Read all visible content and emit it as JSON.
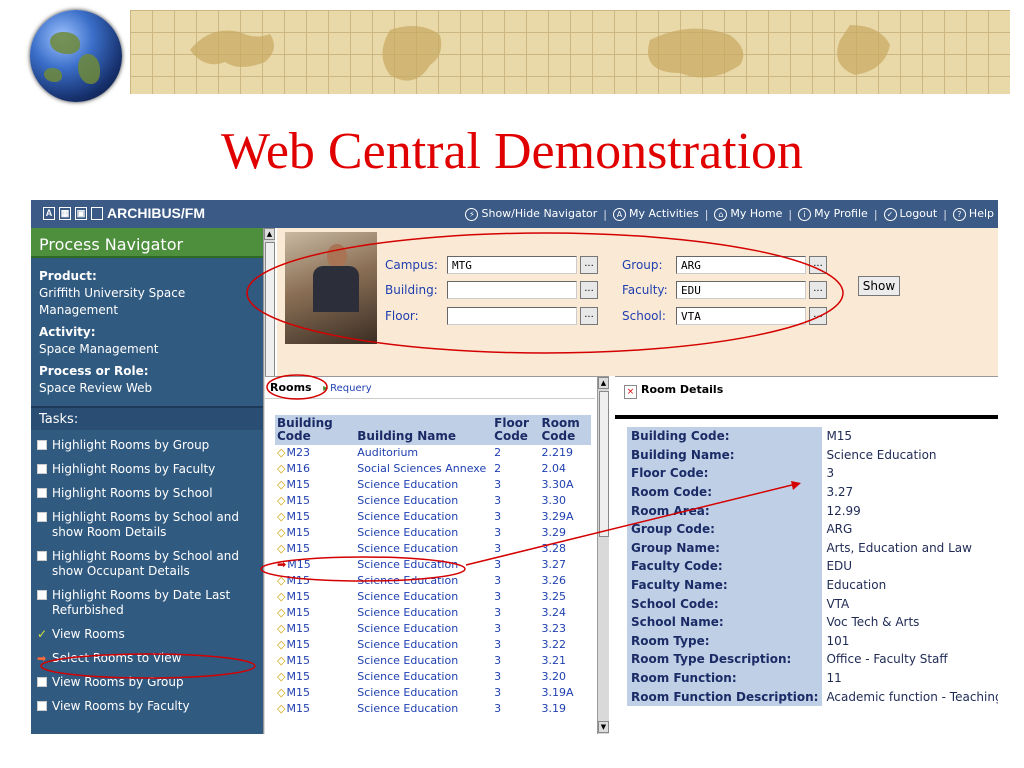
{
  "slide": {
    "title": "Web Central Demonstration"
  },
  "app": {
    "brand": "ARCHIBUS/FM",
    "topnav": [
      {
        "icon": "lightning-icon",
        "label": "Show/Hide Navigator"
      },
      {
        "icon": "activities-icon",
        "label": "My Activities"
      },
      {
        "icon": "home-icon",
        "label": "My Home"
      },
      {
        "icon": "profile-icon",
        "label": "My Profile"
      },
      {
        "icon": "logout-icon",
        "label": "Logout"
      },
      {
        "icon": "help-icon",
        "label": "Help"
      }
    ]
  },
  "navigator": {
    "title": "Process Navigator",
    "product_label": "Product:",
    "product": "Griffith University Space Management",
    "activity_label": "Activity:",
    "activity": "Space Management",
    "role_label": "Process or Role:",
    "role": "Space Review Web",
    "tasks_label": "Tasks:",
    "tasks": [
      {
        "label": "Highlight Rooms by Group",
        "icon": "report-icon"
      },
      {
        "label": "Highlight Rooms by Faculty",
        "icon": "report-icon"
      },
      {
        "label": "Highlight Rooms by School",
        "icon": "report-icon"
      },
      {
        "label": "Highlight Rooms by School and show Room Details",
        "icon": "report-icon"
      },
      {
        "label": "Highlight Rooms by School and show Occupant Details",
        "icon": "report-icon"
      },
      {
        "label": "Highlight Rooms by Date Last Refurbished",
        "icon": "report-icon"
      },
      {
        "label": "View Rooms",
        "icon": "check-icon"
      },
      {
        "label": "Select Rooms to View",
        "icon": "arrow-right-icon"
      },
      {
        "label": "View Rooms by Group",
        "icon": "report-icon"
      },
      {
        "label": "View Rooms by Faculty",
        "icon": "report-icon"
      }
    ]
  },
  "filters": {
    "campus_label": "Campus:",
    "campus": "MTG",
    "building_label": "Building:",
    "building": "",
    "floor_label": "Floor:",
    "floor": "",
    "group_label": "Group:",
    "group": "ARG",
    "faculty_label": "Faculty:",
    "faculty": "EDU",
    "school_label": "School:",
    "school": "VTA",
    "browse": "...",
    "show_button": "Show"
  },
  "rooms": {
    "title": "Rooms",
    "requery": "Requery",
    "headers": [
      "Building Code",
      "Building Name",
      "Floor Code",
      "Room Code"
    ],
    "rows": [
      [
        "M23",
        "Auditorium",
        "2",
        "2.219"
      ],
      [
        "M16",
        "Social Sciences Annexe",
        "2",
        "2.04"
      ],
      [
        "M15",
        "Science Education",
        "3",
        "3.30A"
      ],
      [
        "M15",
        "Science Education",
        "3",
        "3.30"
      ],
      [
        "M15",
        "Science Education",
        "3",
        "3.29A"
      ],
      [
        "M15",
        "Science Education",
        "3",
        "3.29"
      ],
      [
        "M15",
        "Science Education",
        "3",
        "3.28"
      ],
      [
        "M15",
        "Science Education",
        "3",
        "3.27"
      ],
      [
        "M15",
        "Science Education",
        "3",
        "3.26"
      ],
      [
        "M15",
        "Science Education",
        "3",
        "3.25"
      ],
      [
        "M15",
        "Science Education",
        "3",
        "3.24"
      ],
      [
        "M15",
        "Science Education",
        "3",
        "3.23"
      ],
      [
        "M15",
        "Science Education",
        "3",
        "3.22"
      ],
      [
        "M15",
        "Science Education",
        "3",
        "3.21"
      ],
      [
        "M15",
        "Science Education",
        "3",
        "3.20"
      ],
      [
        "M15",
        "Science Education",
        "3",
        "3.19A"
      ],
      [
        "M15",
        "Science Education",
        "3",
        "3.19"
      ]
    ],
    "selected_index": 7,
    "highlight_color": "#d40000"
  },
  "details": {
    "title": "Room Details",
    "rows": [
      [
        "Building Code:",
        "M15"
      ],
      [
        "Building Name:",
        "Science Education"
      ],
      [
        "Floor Code:",
        "3"
      ],
      [
        "Room Code:",
        "3.27"
      ],
      [
        "Room Area:",
        "12.99"
      ],
      [
        "Group Code:",
        "ARG"
      ],
      [
        "Group Name:",
        "Arts, Education and Law"
      ],
      [
        "Faculty Code:",
        "EDU"
      ],
      [
        "Faculty Name:",
        "Education"
      ],
      [
        "School Code:",
        "VTA"
      ],
      [
        "School Name:",
        "Voc Tech & Arts"
      ],
      [
        "Room Type:",
        "101"
      ],
      [
        "Room Type Description:",
        "Office - Faculty Staff"
      ],
      [
        "Room Function:",
        "11"
      ],
      [
        "Room Function Description:",
        "Academic function - Teaching Only"
      ]
    ]
  },
  "colors": {
    "title": "#e00000",
    "header_bar": "#3b5a86",
    "navigator_green": "#4e8f3e",
    "panel_blue": "#315a80",
    "annotation": "#d40000"
  }
}
